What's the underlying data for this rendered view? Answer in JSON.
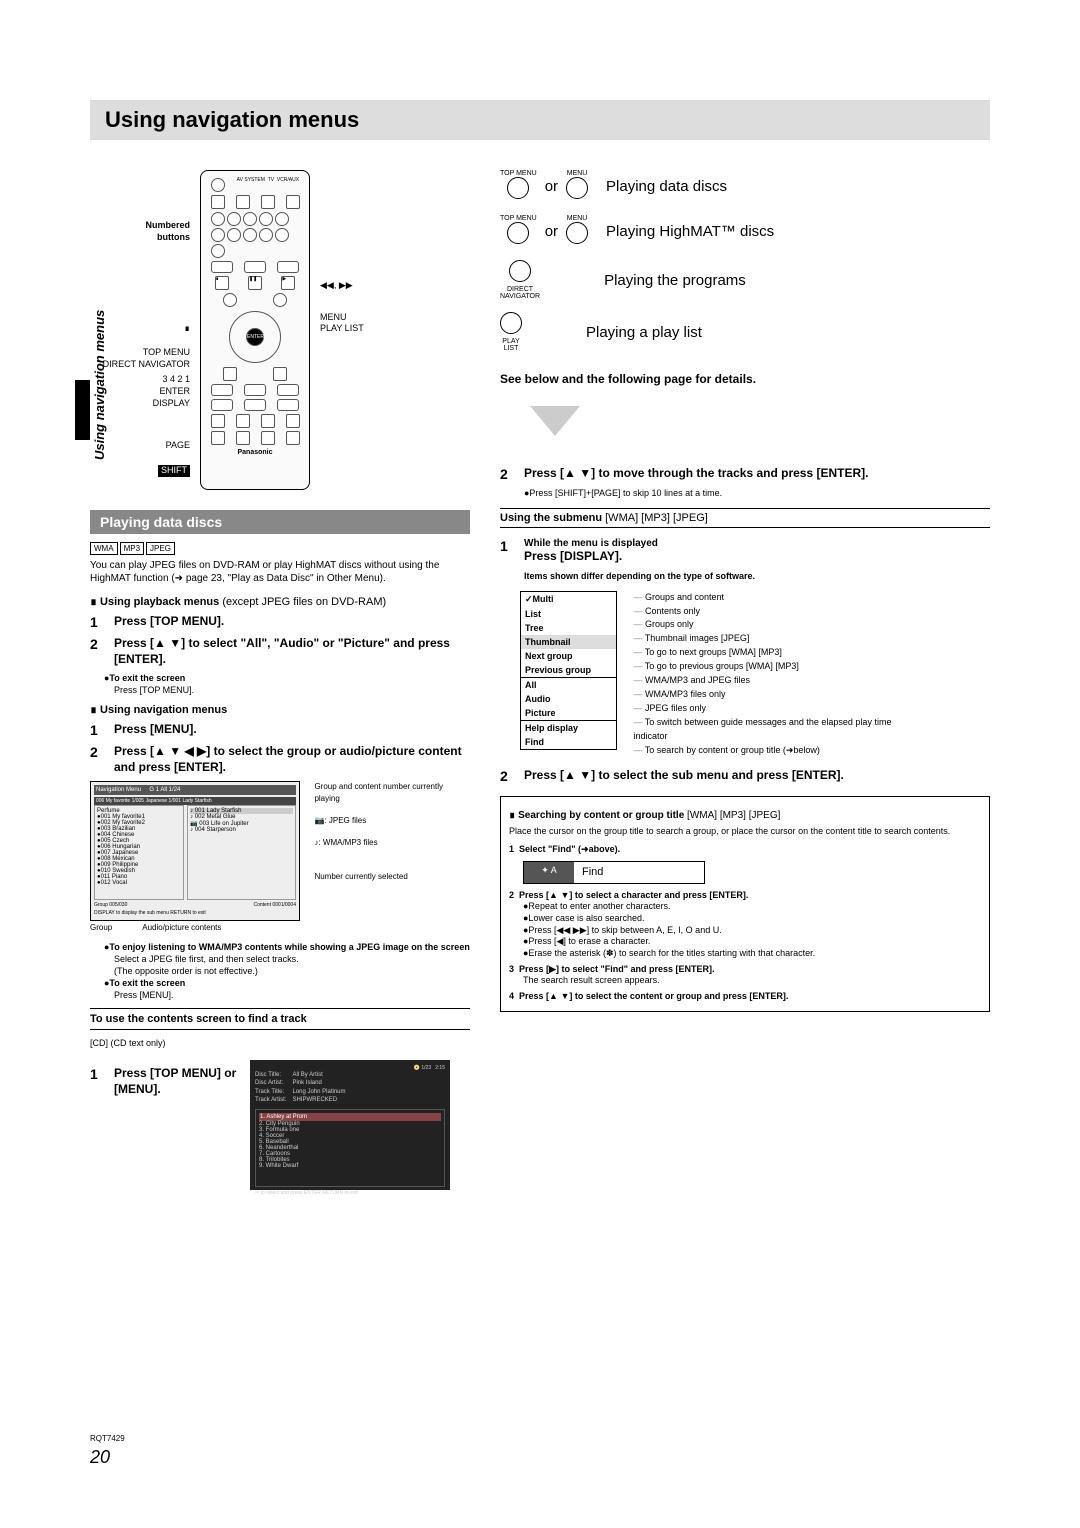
{
  "page_title": "Using navigation menus",
  "sidebar_text": "Using navigation menus",
  "model": "RQT7429",
  "page_number": "20",
  "remote": {
    "left_labels": {
      "numbered": "Numbered\nbuttons",
      "stop": "∎",
      "rev": "◀◀, ▶▶",
      "topmenu": "TOP MENU\nDIRECT NAVIGATOR",
      "menu": "MENU\nPLAY LIST",
      "nums": "3 4 2 1",
      "enter": "ENTER",
      "display": "DISPLAY",
      "page": "PAGE",
      "shift": "SHIFT"
    },
    "brand": "Panasonic"
  },
  "top_actions": {
    "row1": {
      "l1": "TOP MENU",
      "l2": "MENU",
      "or": "or",
      "text": "Playing data discs"
    },
    "row2": {
      "l1": "TOP MENU",
      "l2": "MENU",
      "or": "or",
      "text": "Playing HighMAT™ discs"
    },
    "row3": {
      "l1": "DIRECT\nNAVIGATOR",
      "text": "Playing the programs"
    },
    "row4": {
      "l1": "PLAY\nLIST",
      "text": "Playing a play list"
    }
  },
  "detail_note": "See below and the following page for details.",
  "section1": {
    "title": "Playing data discs",
    "badges": [
      "WMA",
      "MP3",
      "JPEG"
    ],
    "intro": "You can play JPEG files on DVD-RAM or play HighMAT discs without using the HighMAT function (➜ page 23, \"Play as Data Disc\" in Other Menu).",
    "sub1_title": "∎ Using playback menus",
    "sub1_note": "(except JPEG files on DVD-RAM)",
    "s1_1": "Press [TOP MENU].",
    "s1_2": "Press [▲ ▼] to select \"All\", \"Audio\" or \"Picture\" and press [ENTER].",
    "tip1a": "●To exit the screen",
    "tip1b": "Press [TOP MENU].",
    "sub2_title": "∎ Using navigation menus",
    "s2_1": "Press [MENU].",
    "s2_2": "Press [▲ ▼ ◀ ▶] to select the group or audio/picture content and press [ENTER].",
    "nav_notes": {
      "n1": "Group and content number currently playing",
      "n2": "📷: JPEG files",
      "n3": "♪: WMA/MP3 files",
      "n4": "Number currently selected"
    },
    "nav_bottom": {
      "a": "Group",
      "b": "Audio/picture contents"
    },
    "enjoy_h": "●To enjoy listening to WMA/MP3 contents while showing a JPEG image on the screen",
    "enjoy_1": "Select a JPEG file first, and then select tracks.",
    "enjoy_2": "(The opposite order is not effective.)",
    "exit_h": "●To exit the screen",
    "exit_t": "Press [MENU].",
    "cd_h": "To use the contents screen to find a track",
    "cd_note": "[CD] (CD text only)",
    "s3_1": "Press [TOP MENU] or [MENU]."
  },
  "nav_screenshot": {
    "title": "Navigation  Menu",
    "sub": "G  1   All  1/24",
    "hdr2": "006  My favorite 1/005 Japanese 1/001  Lady Starfish",
    "groups": [
      "Perfume",
      "●001 My favorite1",
      "●002 My favorite2",
      "●003 Brazilian",
      "●004 Chinese",
      "●005 Czech",
      "●006 Hungarian",
      "●007 Japanese",
      "●008 Mexican",
      "●009 Philippine",
      "●010 Swedish",
      "●011 Piano",
      "●012 Vocal"
    ],
    "tracks": [
      "♪ 001 Lady Starfish",
      "♪ 002 Metal Glue",
      "📷 003 Life on Jupiter",
      "♪ 004 Starperson"
    ],
    "ftr": {
      "g": "Group  005/030",
      "c": "Content  0001/0004"
    },
    "help": "DISPLAY to display the sub menu      RETURN to exit"
  },
  "cd_screenshot": {
    "disc": "Disc Title:\nDisc Artist:\nTrack Title:\nTrack Artist:",
    "disc_v": "All By Artist\nPink Island\nLong John Platinum\nSHIPWRECKED",
    "tracks": [
      "1. Ashley at Prom",
      "2. City Penguin",
      "3. Formula one",
      "4. Soccer",
      "5. Baseball",
      "6. Neanderthal",
      "7. Cartoons",
      "8. Trilobites",
      "9. White Dwarf"
    ],
    "help": "⏎ to select and press ENTER      RETURN to exit"
  },
  "rcol": {
    "s1_num": "2",
    "s1_text": "Press [▲ ▼] to move through the tracks and press [ENTER].",
    "s1_tip": "●Press [SHIFT]+[PAGE] to skip 10 lines at a time.",
    "sub_h": "Using the submenu",
    "sub_badges": "[WMA] [MP3] [JPEG]",
    "sm1_num": "1",
    "sm1_a": "While the menu is displayed",
    "sm1_b": "Press [DISPLAY].",
    "sm1_note": "Items shown differ depending on the type of software.",
    "menu_items": [
      "✓Multi",
      "List",
      "Tree",
      "Thumbnail",
      "Next group",
      "Previous group",
      "All",
      "Audio",
      "Picture",
      "Help display",
      "Find"
    ],
    "menu_desc": [
      "Groups and content",
      "Contents only",
      "Groups only",
      "Thumbnail images [JPEG]",
      "To go to next groups [WMA] [MP3]",
      "To go to previous groups [WMA] [MP3]",
      "WMA/MP3 and JPEG files",
      "WMA/MP3 files only",
      "JPEG files only",
      "To switch between guide messages and the elapsed play time indicator",
      "To search by content or group title (➜below)"
    ],
    "sm2_num": "2",
    "sm2_text": "Press [▲ ▼] to select the sub menu and press [ENTER].",
    "search": {
      "h": "∎ Searching by content or group title",
      "badges": "[WMA] [MP3] [JPEG]",
      "intro": "Place the cursor on the group title to search a group, or place the cursor on the content title to search contents.",
      "st1": "Select \"Find\" (➜above).",
      "find_l": "✦ A",
      "find_r": "Find",
      "st2": "Press [▲ ▼] to select a character and press [ENTER].",
      "b1": "●Repeat to enter another characters.",
      "b2": "●Lower case is also searched.",
      "b3": "●Press [◀◀ ▶▶] to skip between A, E, I, O and U.",
      "b4": "●Press [◀] to erase a character.",
      "b5": "●Erase the asterisk (✽) to search for the titles starting with that character.",
      "st3": "Press [▶] to select \"Find\" and press [ENTER].",
      "st3b": "The search result screen appears.",
      "st4": "Press [▲ ▼] to select the content or group and press [ENTER]."
    }
  }
}
